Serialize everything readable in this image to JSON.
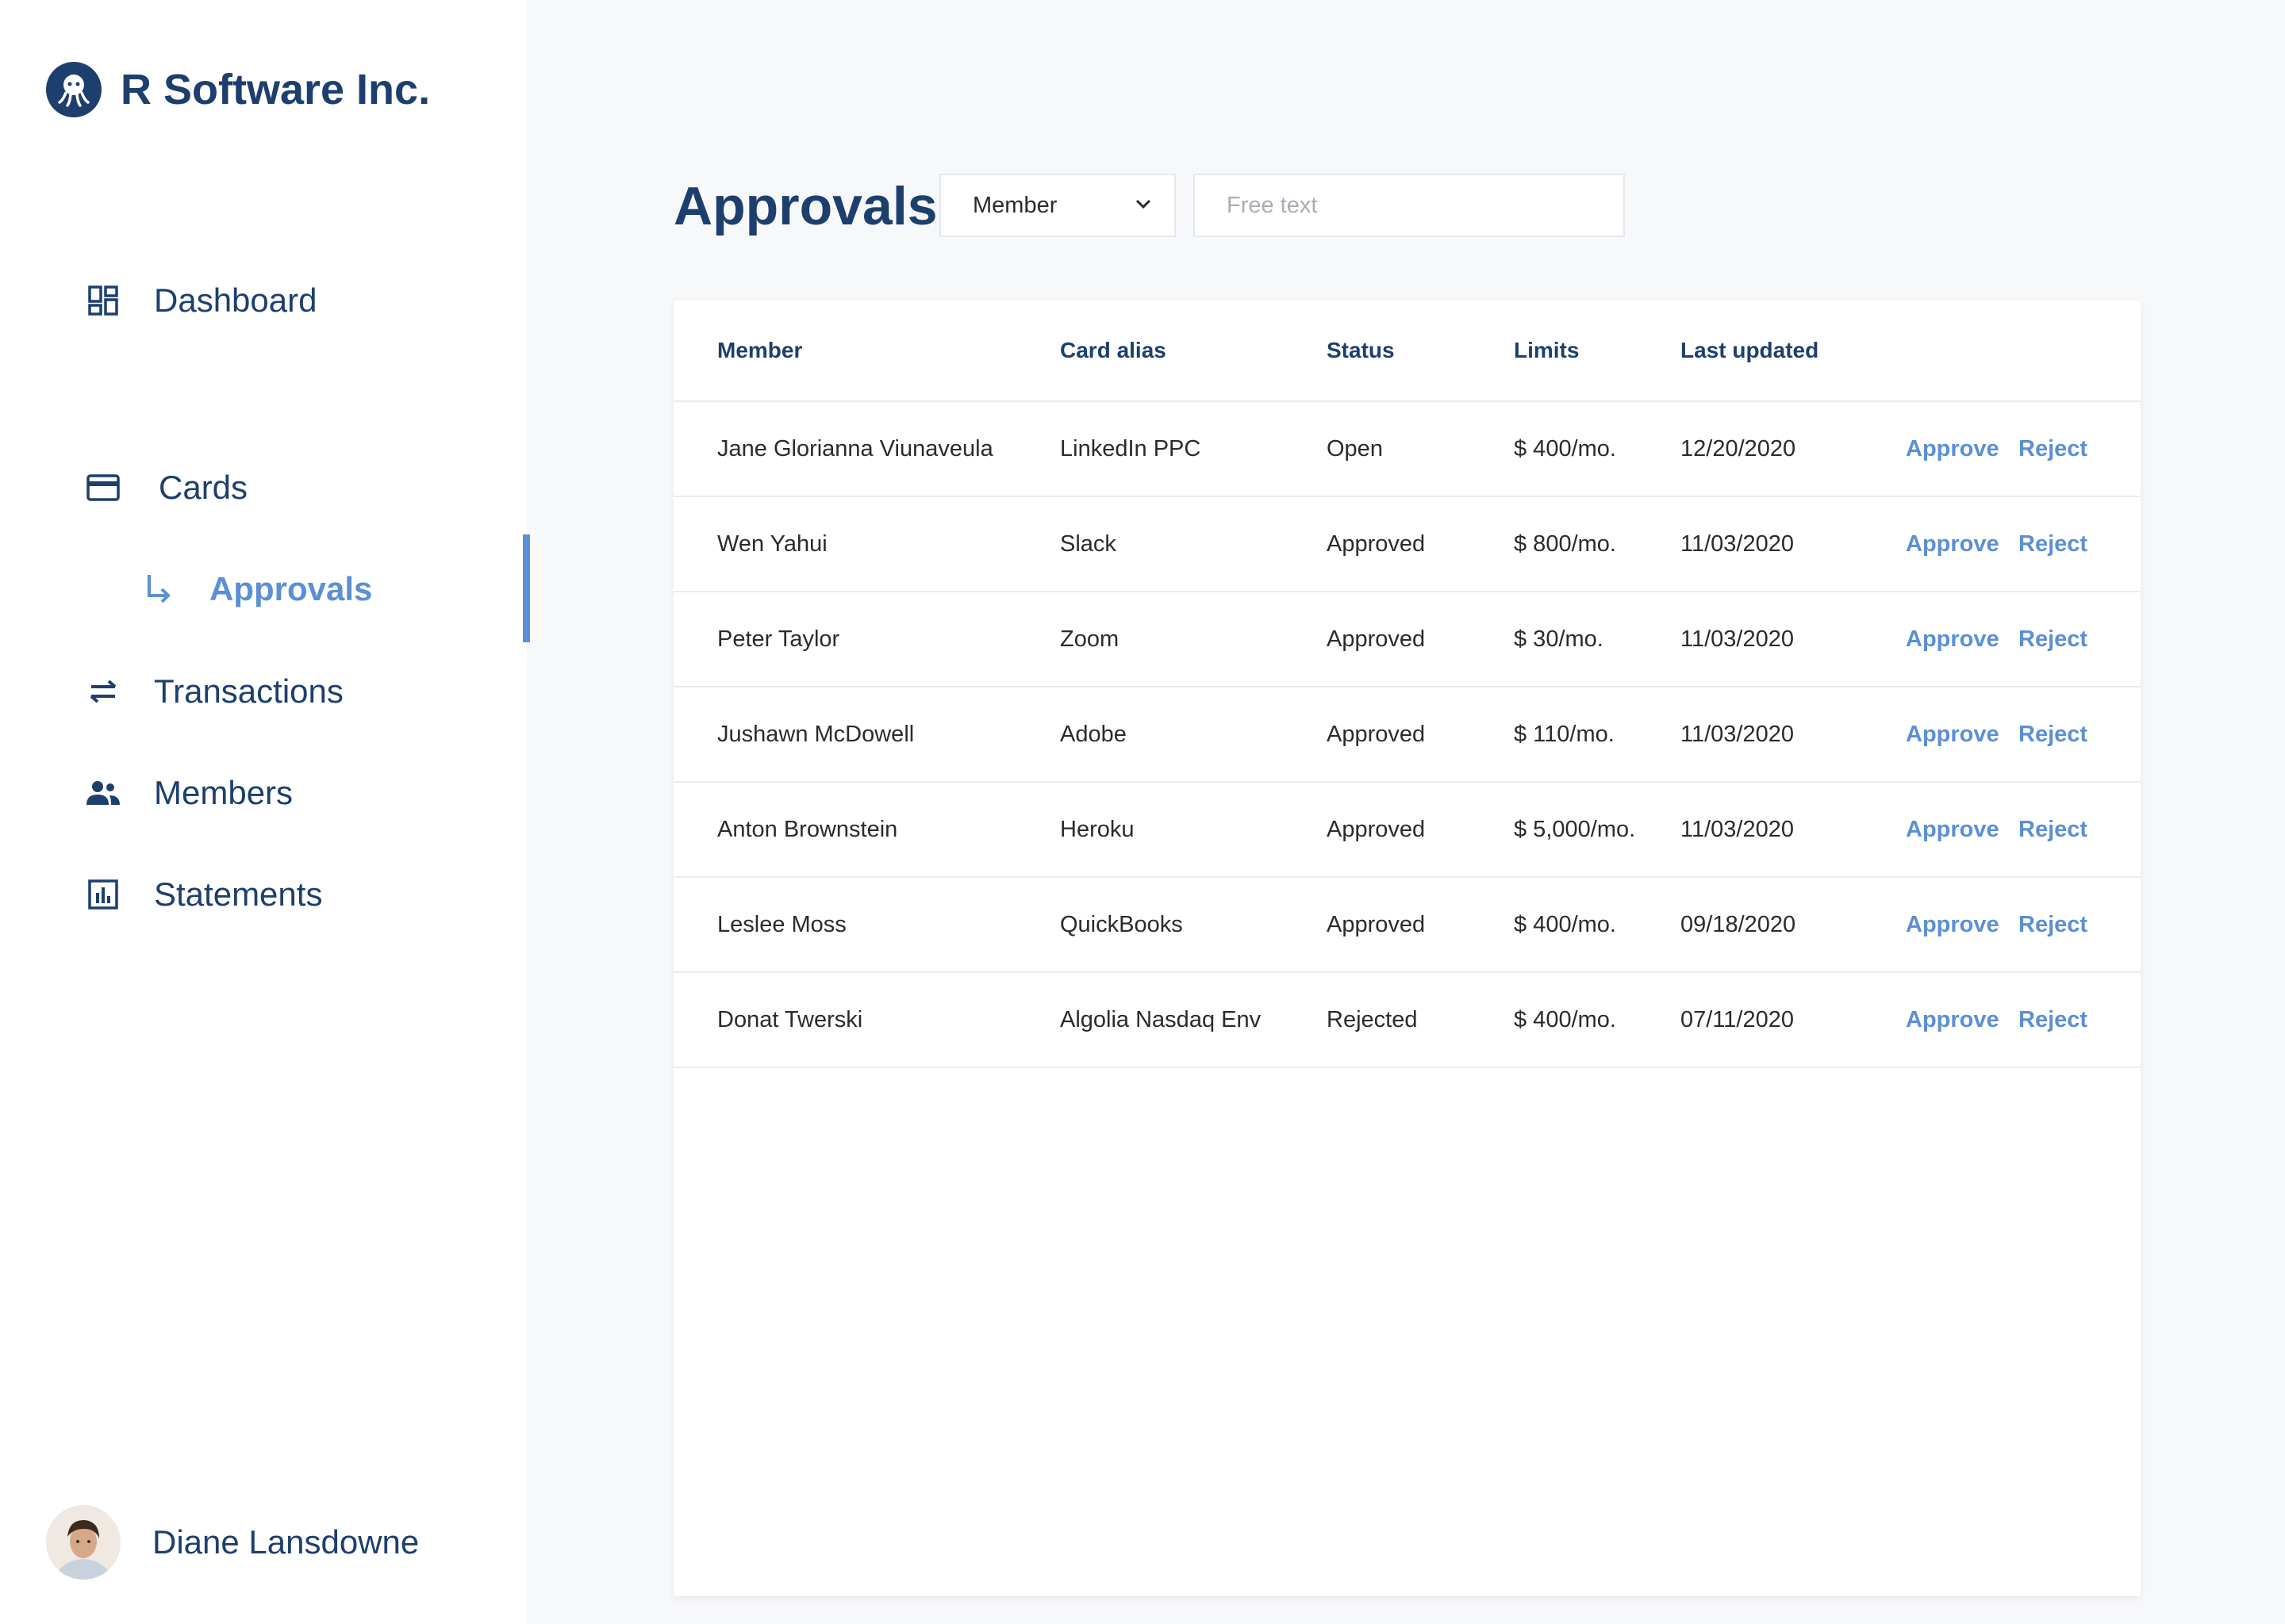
{
  "sidebar": {
    "brand": "R Software Inc.",
    "nav": [
      {
        "label": "Dashboard",
        "icon": "dashboard-icon"
      },
      {
        "label": "Cards",
        "icon": "credit-card-icon"
      },
      {
        "label": "Approvals",
        "icon": "subdirectory-arrow-icon",
        "active": true
      },
      {
        "label": "Transactions",
        "icon": "swap-arrows-icon"
      },
      {
        "label": "Members",
        "icon": "people-icon"
      },
      {
        "label": "Statements",
        "icon": "bar-chart-icon"
      }
    ],
    "user": {
      "name": "Diane Lansdowne"
    }
  },
  "main": {
    "title": "Approvals",
    "filter": {
      "value": "Member"
    },
    "search": {
      "placeholder": "Free text"
    },
    "table": {
      "columns": [
        "Member",
        "Card alias",
        "Status",
        "Limits",
        "Last updated"
      ],
      "action_labels": {
        "approve": "Approve",
        "reject": "Reject"
      },
      "rows": [
        {
          "member": "Jane Glorianna Viunaveula",
          "alias": "LinkedIn PPC",
          "status": "Open",
          "limit": "$ 400/mo.",
          "updated": "12/20/2020"
        },
        {
          "member": "Wen Yahui",
          "alias": "Slack",
          "status": "Approved",
          "limit": "$ 800/mo.",
          "updated": "11/03/2020"
        },
        {
          "member": "Peter Taylor",
          "alias": "Zoom",
          "status": "Approved",
          "limit": "$ 30/mo.",
          "updated": "11/03/2020"
        },
        {
          "member": "Jushawn McDowell",
          "alias": "Adobe",
          "status": "Approved",
          "limit": "$ 110/mo.",
          "updated": "11/03/2020"
        },
        {
          "member": "Anton Brownstein",
          "alias": "Heroku",
          "status": "Approved",
          "limit": "$ 5,000/mo.",
          "updated": "11/03/2020"
        },
        {
          "member": "Leslee Moss",
          "alias": "QuickBooks",
          "status": "Approved",
          "limit": "$ 400/mo.",
          "updated": "09/18/2020"
        },
        {
          "member": "Donat Twerski",
          "alias": "Algolia Nasdaq Env",
          "status": "Rejected",
          "limit": "$ 400/mo.",
          "updated": "07/11/2020"
        }
      ]
    }
  },
  "colors": {
    "primary": "#1d3f6e",
    "accent": "#5b8fd6",
    "background": "#f7f8fa"
  }
}
